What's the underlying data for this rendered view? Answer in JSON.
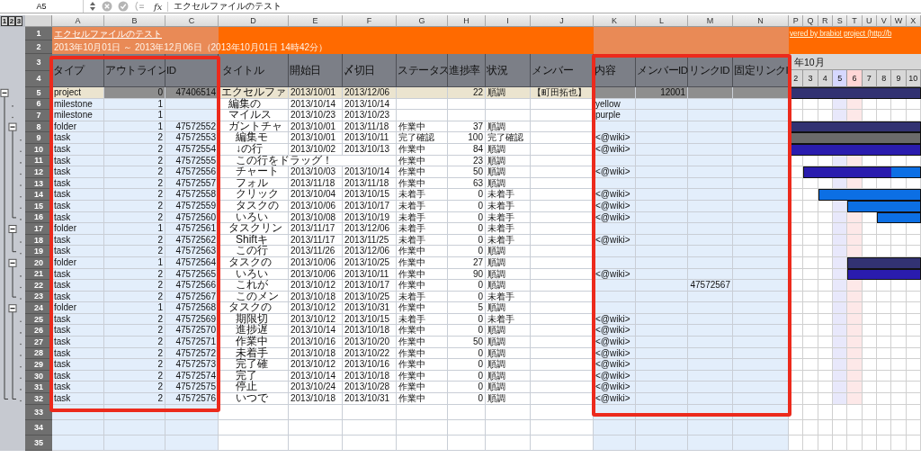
{
  "formula_bar": {
    "cell": "A5",
    "function_label": "fx",
    "value": "エクセルファイルのテスト"
  },
  "outline_levels": [
    "1",
    "2",
    "3"
  ],
  "columns": [
    "A",
    "B",
    "C",
    "D",
    "E",
    "F",
    "G",
    "H",
    "I",
    "J",
    "K",
    "L",
    "M",
    "N"
  ],
  "gantt_columns": [
    "P",
    "Q",
    "R",
    "S",
    "T",
    "U",
    "V",
    "W",
    "X"
  ],
  "banner": {
    "row_1": "1",
    "row_2": "2",
    "title": "エクセルファイルのテスト",
    "period": "2013年10月01日 ～ 2013年12月06日（2013年10月01日 14時42分）",
    "credit": "vered by brabio! project (http://b"
  },
  "header_rows": [
    "3",
    "4"
  ],
  "headers": [
    "タイプ",
    "アウトライン",
    "ID",
    "タイトル",
    "開始日",
    "〆切日",
    "ステータス",
    "進捗率",
    "状況",
    "メンバー",
    "内容",
    "メンバーID",
    "リンクID",
    "固定リンクI"
  ],
  "gantt": {
    "month": "年10月",
    "days": [
      {
        "label": "2",
        "kind": "weekday"
      },
      {
        "label": "3",
        "kind": "weekday"
      },
      {
        "label": "4",
        "kind": "weekday"
      },
      {
        "label": "5",
        "kind": "saturday"
      },
      {
        "label": "6",
        "kind": "sunday"
      },
      {
        "label": "7",
        "kind": "weekday"
      },
      {
        "label": "8",
        "kind": "weekday"
      },
      {
        "label": "9",
        "kind": "weekday"
      },
      {
        "label": "10",
        "kind": "weekday"
      }
    ]
  },
  "rows": [
    {
      "row": "5",
      "kind": "project",
      "expanded": true,
      "type": "project",
      "outline": "0",
      "id": "47406514",
      "title": "エクセルファ",
      "start": "2013/10/01",
      "end": "2013/12/06",
      "progress": "22",
      "state": "順調",
      "member": "【町田拓也】",
      "member_id": "12001",
      "children": [
        {
          "row": "6",
          "kind": "milestone",
          "type": "milestone",
          "outline": "1",
          "title": "編集の",
          "start": "2013/10/14",
          "end": "2013/10/14",
          "content": "yellow"
        },
        {
          "row": "7",
          "kind": "milestone",
          "type": "milestone",
          "outline": "1",
          "title": "マイルス",
          "start": "2013/10/23",
          "end": "2013/10/23",
          "content": "purple"
        },
        {
          "row": "8",
          "kind": "folder",
          "expanded": true,
          "type": "folder",
          "outline": "1",
          "id": "47572552",
          "title": "ガントチャ",
          "start": "2013/10/01",
          "end": "2013/11/18",
          "status": "作業中",
          "progress": "37",
          "state": "順調",
          "children": [
            {
              "row": "9",
              "kind": "completed-task",
              "type": "task",
              "outline": "2",
              "id": "47572553",
              "title": "編集モ",
              "start": "2013/10/01",
              "end": "2013/10/11",
              "status": "完了確認",
              "progress": "100",
              "state": "完了確認",
              "content": "<@wiki>"
            },
            {
              "row": "10",
              "kind": "task",
              "type": "task",
              "outline": "2",
              "id": "47572554",
              "title": "↓の行",
              "start": "2013/10/02",
              "end": "2013/10/13",
              "status": "作業中",
              "progress": "84",
              "state": "順調",
              "content": "<@wiki>"
            },
            {
              "row": "11",
              "kind": "task",
              "type": "task",
              "outline": "2",
              "id": "47572555",
              "title": "この行をドラッグ！",
              "status": "作業中",
              "progress": "23",
              "state": "順調"
            },
            {
              "row": "12",
              "kind": "task",
              "type": "task",
              "outline": "2",
              "id": "47572556",
              "title": "チャート",
              "start": "2013/10/03",
              "end": "2013/10/14",
              "status": "作業中",
              "progress": "50",
              "state": "順調",
              "content": "<@wiki>"
            },
            {
              "row": "13",
              "kind": "task",
              "type": "task",
              "outline": "2",
              "id": "47572557",
              "title": "フォル",
              "start": "2013/11/18",
              "end": "2013/11/18",
              "status": "作業中",
              "progress": "63",
              "state": "順調"
            },
            {
              "row": "14",
              "kind": "task",
              "type": "task",
              "outline": "2",
              "id": "47572558",
              "title": "クリック",
              "start": "2013/10/04",
              "end": "2013/10/15",
              "status": "未着手",
              "progress": "0",
              "state": "未着手",
              "content": "<@wiki>"
            },
            {
              "row": "15",
              "kind": "task",
              "type": "task",
              "outline": "2",
              "id": "47572559",
              "title": "タスクの",
              "start": "2013/10/06",
              "end": "2013/10/17",
              "status": "未着手",
              "progress": "0",
              "state": "未着手",
              "content": "<@wiki>"
            },
            {
              "row": "16",
              "kind": "task",
              "type": "task",
              "outline": "2",
              "id": "47572560",
              "title": "いろい",
              "start": "2013/10/08",
              "end": "2013/10/19",
              "status": "未着手",
              "progress": "0",
              "state": "未着手",
              "content": "<@wiki>"
            }
          ]
        },
        {
          "row": "17",
          "kind": "folder",
          "expanded": true,
          "type": "folder",
          "outline": "1",
          "id": "47572561",
          "title": "タスクリン",
          "start": "2013/11/17",
          "end": "2013/12/06",
          "status": "未着手",
          "progress": "0",
          "state": "未着手",
          "children": [
            {
              "row": "18",
              "kind": "task",
              "type": "task",
              "outline": "2",
              "id": "47572562",
              "title": "Shiftキ",
              "start": "2013/11/17",
              "end": "2013/11/25",
              "status": "未着手",
              "progress": "0",
              "state": "未着手",
              "content": "<@wiki>"
            },
            {
              "row": "19",
              "kind": "task",
              "type": "task",
              "outline": "2",
              "id": "47572563",
              "title": "この行",
              "start": "2013/11/26",
              "end": "2013/12/06",
              "status": "作業中",
              "progress": "0",
              "state": "順調"
            }
          ]
        },
        {
          "row": "20",
          "kind": "folder",
          "expanded": true,
          "type": "folder",
          "outline": "1",
          "id": "47572564",
          "title": "タスクの",
          "start": "2013/10/06",
          "end": "2013/10/25",
          "status": "作業中",
          "progress": "27",
          "state": "順調",
          "children": [
            {
              "row": "21",
              "kind": "task",
              "type": "task",
              "outline": "2",
              "id": "47572565",
              "title": "いろい",
              "start": "2013/10/06",
              "end": "2013/10/11",
              "status": "作業中",
              "progress": "90",
              "state": "順調",
              "content": "<@wiki>"
            },
            {
              "row": "22",
              "kind": "task",
              "type": "task",
              "outline": "2",
              "id": "47572566",
              "title": "これが",
              "start": "2013/10/12",
              "end": "2013/10/17",
              "status": "作業中",
              "progress": "0",
              "state": "順調",
              "link_id": "47572567"
            },
            {
              "row": "23",
              "kind": "task",
              "type": "task",
              "outline": "2",
              "id": "47572567",
              "title": "このメン",
              "start": "2013/10/18",
              "end": "2013/10/25",
              "status": "未着手",
              "progress": "0",
              "state": "未着手"
            }
          ]
        },
        {
          "row": "24",
          "kind": "folder",
          "expanded": true,
          "type": "folder",
          "outline": "1",
          "id": "47572568",
          "title": "タスクの",
          "start": "2013/10/12",
          "end": "2013/10/31",
          "status": "作業中",
          "progress": "5",
          "state": "順調",
          "children": [
            {
              "row": "25",
              "kind": "task",
              "type": "task",
              "outline": "2",
              "id": "47572569",
              "title": "期限切",
              "start": "2013/10/12",
              "end": "2013/10/15",
              "status": "未着手",
              "progress": "0",
              "state": "未着手",
              "content": "<@wiki>"
            },
            {
              "row": "26",
              "kind": "task",
              "type": "task",
              "outline": "2",
              "id": "47572570",
              "title": "進捗遅",
              "start": "2013/10/14",
              "end": "2013/10/18",
              "status": "作業中",
              "progress": "0",
              "state": "順調",
              "content": "<@wiki>"
            },
            {
              "row": "27",
              "kind": "task",
              "type": "task",
              "outline": "2",
              "id": "47572571",
              "title": "作業中",
              "start": "2013/10/16",
              "end": "2013/10/20",
              "status": "作業中",
              "progress": "50",
              "state": "順調",
              "content": "<@wiki>"
            },
            {
              "row": "28",
              "kind": "task",
              "type": "task",
              "outline": "2",
              "id": "47572572",
              "title": "未着手",
              "start": "2013/10/18",
              "end": "2013/10/22",
              "status": "作業中",
              "progress": "0",
              "state": "順調",
              "content": "<@wiki>"
            },
            {
              "row": "29",
              "kind": "task",
              "type": "task",
              "outline": "2",
              "id": "47572573",
              "title": "完了確",
              "start": "2013/10/12",
              "end": "2013/10/16",
              "status": "作業中",
              "progress": "0",
              "state": "順調",
              "content": "<@wiki>"
            },
            {
              "row": "30",
              "kind": "task",
              "type": "task",
              "outline": "2",
              "id": "47572574",
              "title": "完了",
              "start": "2013/10/14",
              "end": "2013/10/18",
              "status": "作業中",
              "progress": "0",
              "state": "順調",
              "content": "<@wiki>"
            },
            {
              "row": "31",
              "kind": "task",
              "type": "task",
              "outline": "2",
              "id": "47572575",
              "title": "停止",
              "start": "2013/10/24",
              "end": "2013/10/28",
              "status": "作業中",
              "progress": "0",
              "state": "順調",
              "content": "<@wiki>"
            },
            {
              "row": "32",
              "kind": "task",
              "type": "task",
              "outline": "2",
              "id": "47572576",
              "title": "いつで",
              "start": "2013/10/18",
              "end": "2013/10/31",
              "status": "作業中",
              "progress": "0",
              "state": "順調",
              "content": "<@wiki>"
            }
          ]
        }
      ]
    }
  ],
  "empty_rows": [
    "33",
    "34",
    "35"
  ]
}
